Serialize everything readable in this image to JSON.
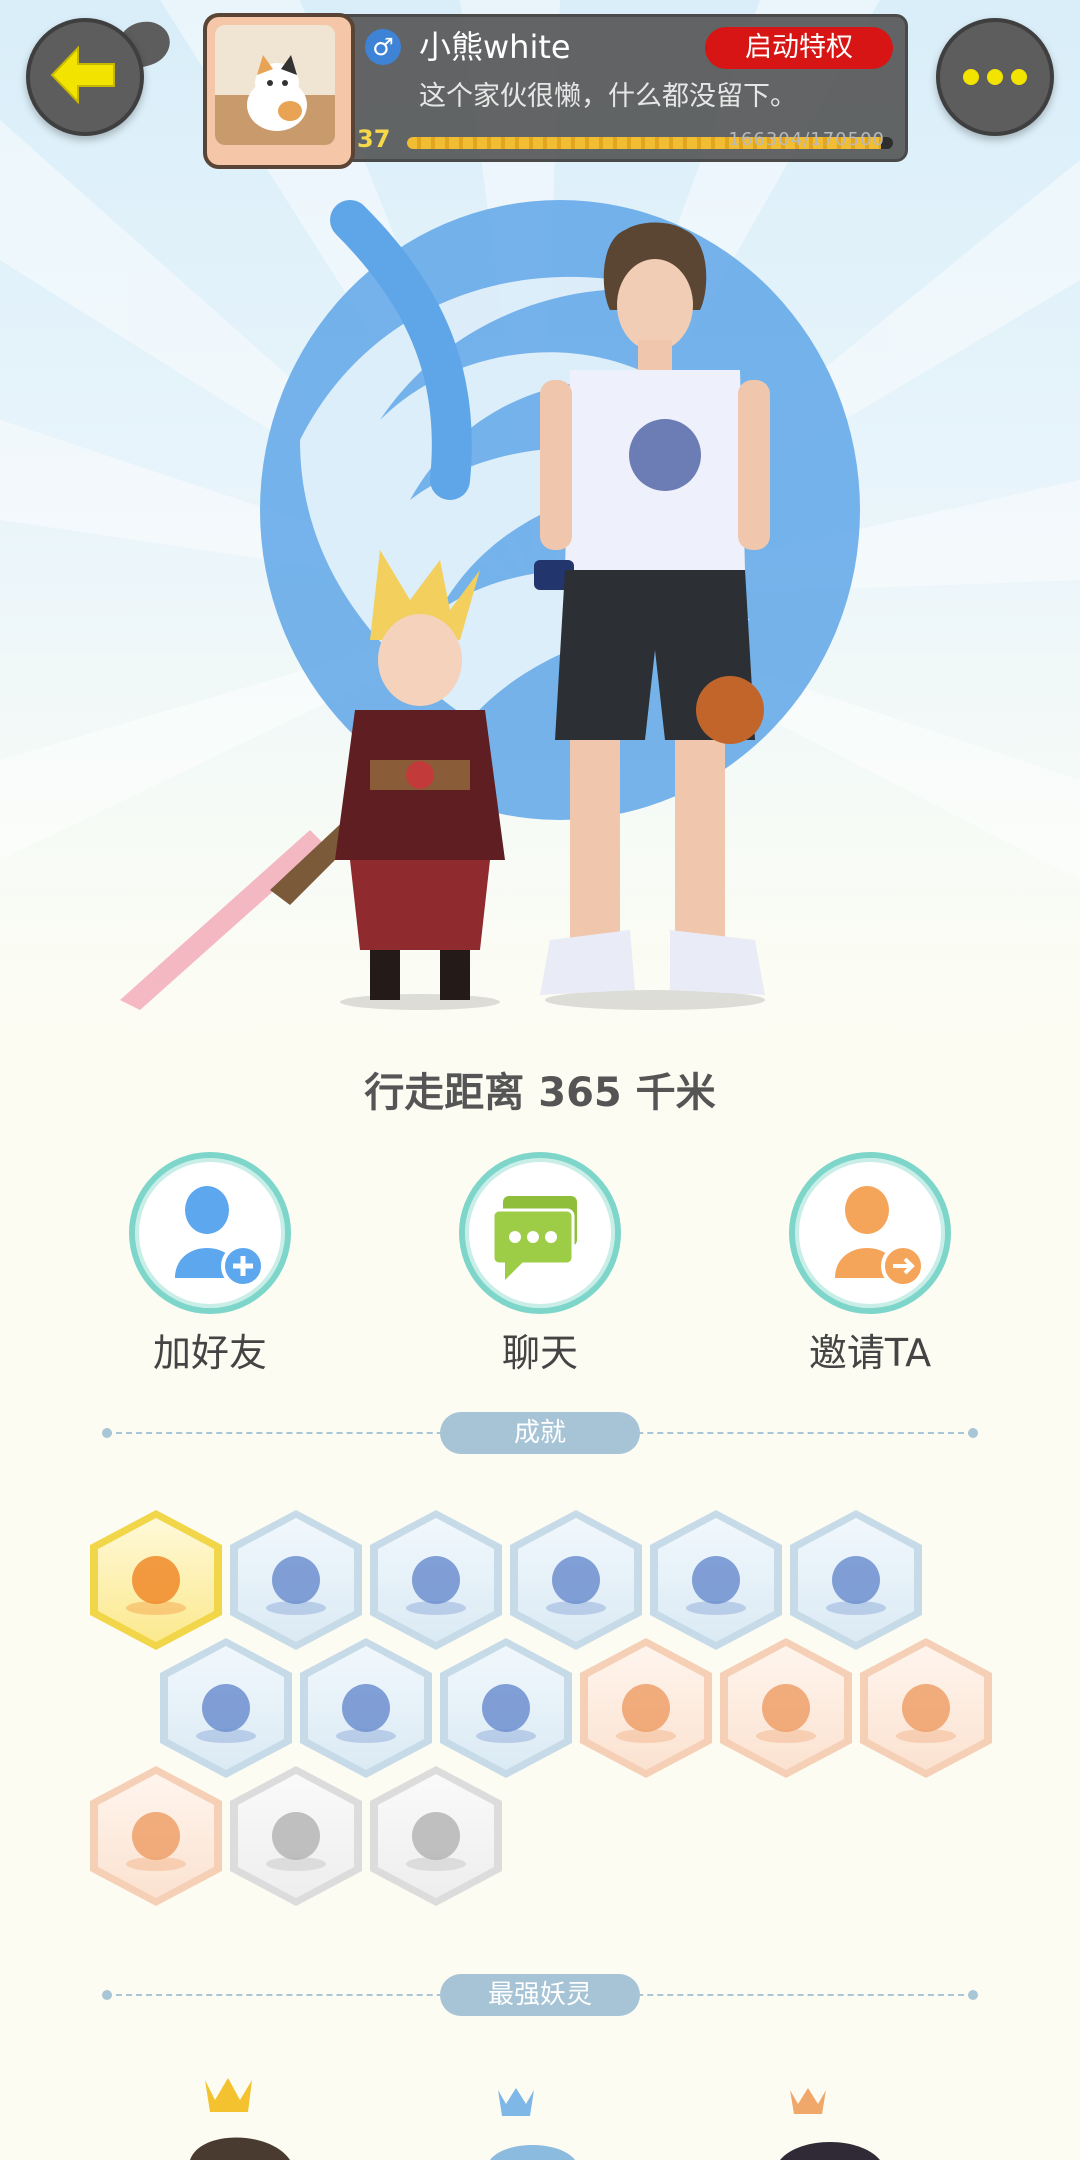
{
  "profile": {
    "username": "小熊white",
    "gender_symbol": "♂",
    "signature": "这个家伙很懒，什么都没留下。",
    "vip_label": "启动特权",
    "level": "37",
    "xp_text": "166304/170500",
    "xp_progress": 0.975
  },
  "stats": {
    "distance_text": "行走距离 365 千米"
  },
  "actions": [
    {
      "label": "加好友",
      "icon": "add-friend-icon"
    },
    {
      "label": "聊天",
      "icon": "chat-icon"
    },
    {
      "label": "邀请TA",
      "icon": "invite-icon"
    }
  ],
  "sections": {
    "achievements_title": "成就",
    "strongest_title": "最强妖灵"
  },
  "colors": {
    "accent_red": "#d81515",
    "xp_gold": "#f1bd33",
    "badge_blue": "#c6dbe7",
    "badge_gold": "#f2d64a",
    "badge_orange": "#f5cfb6",
    "badge_grey": "#dcdcdc"
  },
  "achievements": [
    {
      "icon": "fox-mascot-badge",
      "tier": "gold"
    },
    {
      "icon": "sneaker-badge",
      "tier": "blue"
    },
    {
      "icon": "portal-badge",
      "tier": "blue"
    },
    {
      "icon": "moon-badge",
      "tier": "blue"
    },
    {
      "icon": "crystal-ball-badge",
      "tier": "blue"
    },
    {
      "icon": "gem-badge",
      "tier": "blue"
    },
    {
      "icon": "yin-yang-wave-badge",
      "tier": "blue"
    },
    {
      "icon": "spirit-cat-badge",
      "tier": "blue"
    },
    {
      "icon": "yin-yang-scroll-badge",
      "tier": "blue"
    },
    {
      "icon": "monkey-badge",
      "tier": "orange"
    },
    {
      "icon": "dancer-badge",
      "tier": "orange"
    },
    {
      "icon": "scroll-target-badge",
      "tier": "orange"
    },
    {
      "icon": "ox-badge",
      "tier": "orange"
    },
    {
      "icon": "cart-badge",
      "tier": "grey"
    },
    {
      "icon": "book-fox-badge",
      "tier": "grey"
    }
  ]
}
